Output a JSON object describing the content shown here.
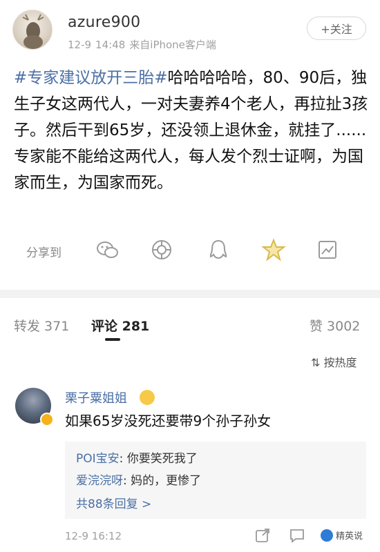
{
  "post": {
    "username": "azure900",
    "date": "12-9",
    "time": "14:48",
    "source": "来自iPhone客户端",
    "follow_label": "+关注",
    "hashtag": "#专家建议放开三胎#",
    "body": "哈哈哈哈哈，80、90后，独生子女这两代人，一对夫妻养4个老人，再拉扯3孩子。然后干到65岁，还没领上退休金，就挂了......专家能不能给这两代人，每人发个烈士证啊，为国家而生，为国家而死。"
  },
  "share": {
    "label": "分享到",
    "icons": [
      "wechat-icon",
      "moments-icon",
      "qq-icon",
      "qzone-icon",
      "favorite-icon"
    ]
  },
  "tabs": {
    "repost": "转发 371",
    "comments": "评论 281",
    "likes": "赞 3002"
  },
  "sort": {
    "label": "按热度"
  },
  "comment": {
    "name": "栗子粟姐姐",
    "text": "如果65岁没死还要带9个孙子孙女",
    "replies": [
      {
        "name": "POI宝安",
        "text": "你要笑死我了"
      },
      {
        "name": "爱浣浣呀",
        "text": "妈的，更惨了"
      }
    ],
    "more_label": "共88条回复 >",
    "time": "12-9 16:12"
  },
  "watermark": {
    "label": "精英说"
  },
  "colors": {
    "link_blue": "#4a6fa5",
    "meta_gray": "#a0a0a0",
    "share_yellow": "#f2c94c"
  }
}
